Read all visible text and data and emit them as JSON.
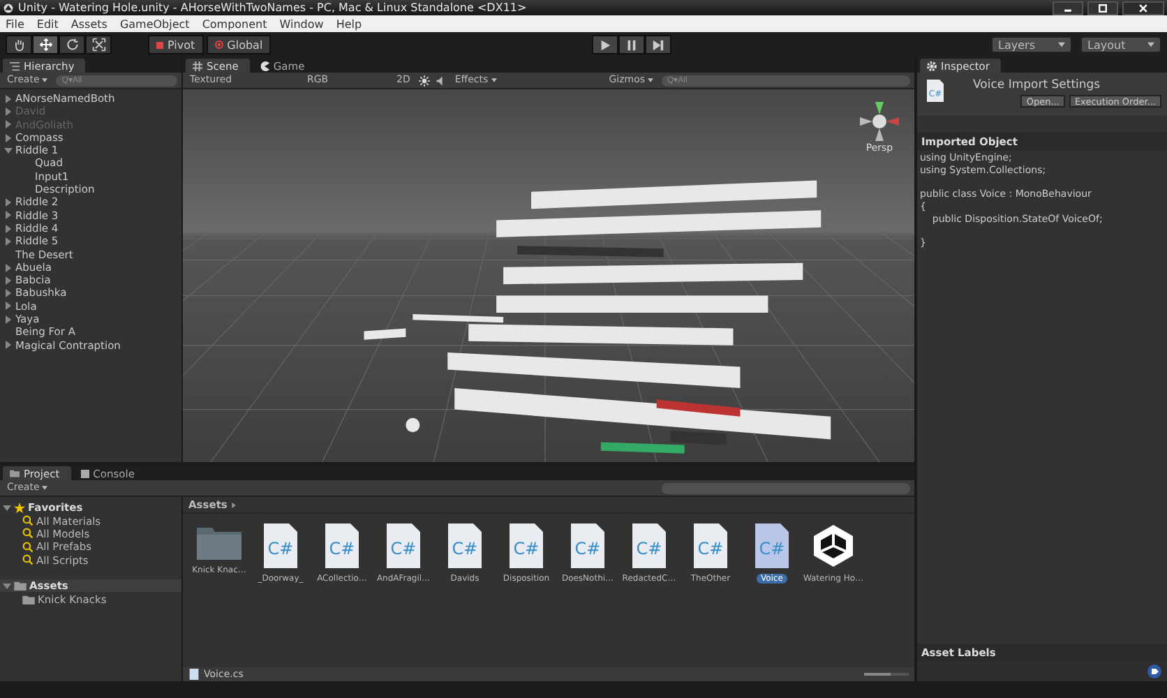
{
  "window": {
    "title": "Unity - Watering Hole.unity - AHorseWithTwoNames - PC, Mac & Linux Standalone <DX11>"
  },
  "menu": [
    "File",
    "Edit",
    "Assets",
    "GameObject",
    "Component",
    "Window",
    "Help"
  ],
  "toolbar": {
    "tools": [
      {
        "kind": "hand",
        "selected": false
      },
      {
        "kind": "move",
        "selected": true
      },
      {
        "kind": "rotate",
        "selected": false
      },
      {
        "kind": "scale",
        "selected": false
      }
    ],
    "pivot": "Pivot",
    "global": "Global",
    "layers": "Layers",
    "layout": "Layout"
  },
  "hierarchy": {
    "title": "Hierarchy",
    "create": "Create",
    "search": {
      "placeholder": "Q▾All"
    },
    "items": [
      {
        "label": "ANorseNamedBoth",
        "expandable": true,
        "expanded": false,
        "disabled": false
      },
      {
        "label": "David",
        "expandable": true,
        "expanded": false,
        "disabled": true
      },
      {
        "label": "AndGoliath",
        "expandable": true,
        "expanded": false,
        "disabled": true
      },
      {
        "label": "Compass",
        "expandable": true,
        "expanded": false,
        "disabled": false
      },
      {
        "label": "Riddle 1",
        "expandable": true,
        "expanded": true,
        "disabled": false,
        "children": [
          {
            "label": "Quad",
            "expandable": false,
            "disabled": false
          },
          {
            "label": "Input1",
            "expandable": false,
            "disabled": false
          },
          {
            "label": "Description",
            "expandable": false,
            "disabled": false
          }
        ]
      },
      {
        "label": "Riddle 2",
        "expandable": true,
        "expanded": false,
        "disabled": false
      },
      {
        "label": "Riddle 3",
        "expandable": true,
        "expanded": false,
        "disabled": false
      },
      {
        "label": "Riddle 4",
        "expandable": true,
        "expanded": false,
        "disabled": false
      },
      {
        "label": "Riddle 5",
        "expandable": true,
        "expanded": false,
        "disabled": false
      },
      {
        "label": "The Desert",
        "expandable": false,
        "disabled": false
      },
      {
        "label": "Abuela",
        "expandable": true,
        "expanded": false,
        "disabled": false
      },
      {
        "label": "Babcia",
        "expandable": true,
        "expanded": false,
        "disabled": false
      },
      {
        "label": "Babushka",
        "expandable": true,
        "expanded": false,
        "disabled": false
      },
      {
        "label": "Lola",
        "expandable": true,
        "expanded": false,
        "disabled": false
      },
      {
        "label": "Yaya",
        "expandable": true,
        "expanded": false,
        "disabled": false
      },
      {
        "label": "Being For A",
        "expandable": false,
        "disabled": false
      },
      {
        "label": "Magical Contraption",
        "expandable": true,
        "expanded": false,
        "disabled": false
      }
    ]
  },
  "scene": {
    "tabs": [
      {
        "label": "Scene",
        "kind": "scene",
        "selected": true
      },
      {
        "label": "Game",
        "kind": "game",
        "selected": false
      }
    ],
    "shading": "Textured",
    "channel": "RGB",
    "mode_2d": "2D",
    "effects": "Effects",
    "gizmos": "Gizmos",
    "search": {
      "placeholder": "Q▾All"
    },
    "projection": "Persp"
  },
  "inspector": {
    "title": "Inspector",
    "heading": "Voice Import Settings",
    "icon_text": "C#",
    "buttons": [
      "Open...",
      "Execution Order..."
    ],
    "section": "Imported Object",
    "code": [
      [
        "using UnityEngine;",
        "using System.Collections;"
      ],
      [
        "public class Voice : MonoBehaviour",
        "{",
        "    public Disposition.StateOf VoiceOf;"
      ],
      [
        "}"
      ]
    ],
    "labels_title": "Asset Labels"
  },
  "project": {
    "tabs": [
      {
        "label": "Project",
        "kind": "project",
        "selected": true
      },
      {
        "label": "Console",
        "kind": "console",
        "selected": false
      }
    ],
    "create": "Create",
    "favorites": {
      "label": "Favorites",
      "items": [
        "All Materials",
        "All Models",
        "All Prefabs",
        "All Scripts"
      ]
    },
    "tree": {
      "label": "Assets",
      "children": [
        "Knick Knacks"
      ]
    },
    "breadcrumb": "Assets",
    "assets": [
      {
        "name": "Knick Knac…",
        "kind": "folder",
        "selected": false
      },
      {
        "name": "_Doorway_",
        "kind": "script",
        "icon_text": "C#",
        "selected": false
      },
      {
        "name": "ACollectio…",
        "kind": "script",
        "icon_text": "C#",
        "selected": false
      },
      {
        "name": "AndAFragil…",
        "kind": "script",
        "icon_text": "C#",
        "selected": false
      },
      {
        "name": "Davids",
        "kind": "script",
        "icon_text": "C#",
        "selected": false
      },
      {
        "name": "Disposition",
        "kind": "script",
        "icon_text": "C#",
        "selected": false
      },
      {
        "name": "DoesNothi…",
        "kind": "script",
        "icon_text": "C#",
        "selected": false
      },
      {
        "name": "RedactedC…",
        "kind": "script",
        "icon_text": "C#",
        "selected": false
      },
      {
        "name": "TheOther",
        "kind": "script",
        "icon_text": "C#",
        "selected": false
      },
      {
        "name": "Voice",
        "kind": "script",
        "icon_text": "C#",
        "selected": true
      },
      {
        "name": "Watering Ho…",
        "kind": "scene",
        "selected": false
      }
    ],
    "footer": "Voice.cs",
    "zoom": {
      "level": 0.6
    }
  }
}
